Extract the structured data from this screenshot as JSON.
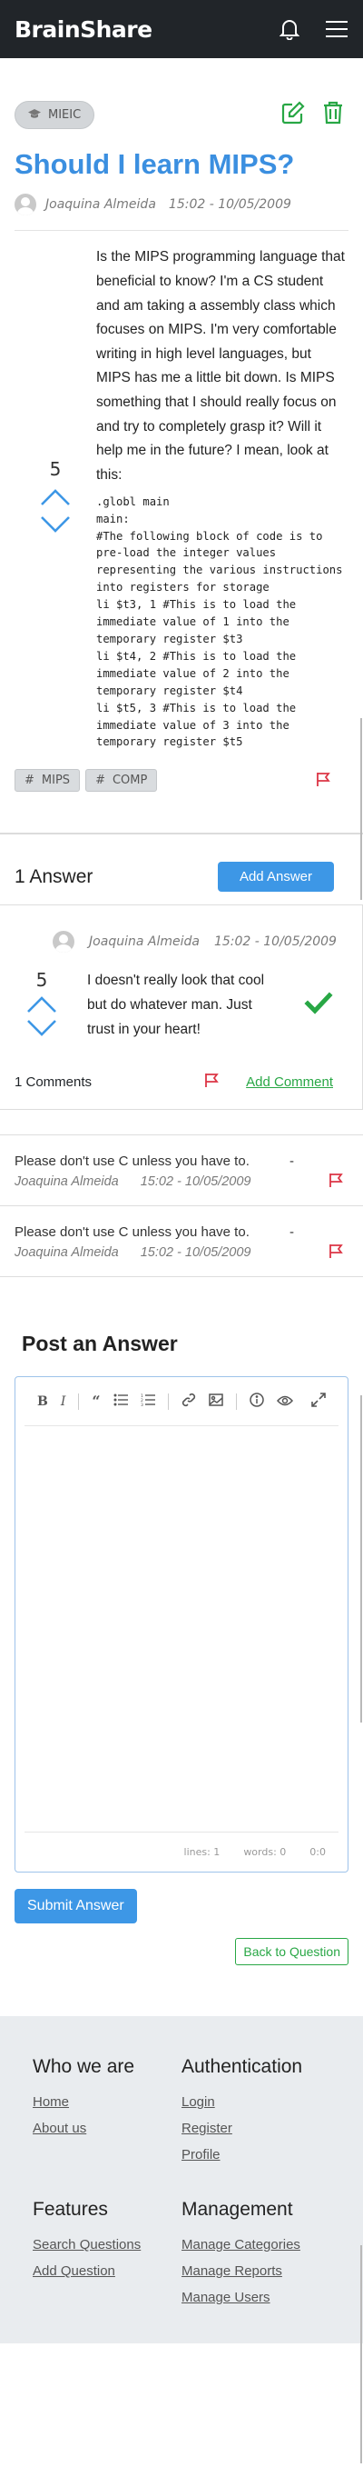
{
  "navbar": {
    "brand": "BrainShare",
    "icons": [
      "bell-icon",
      "menu-icon"
    ]
  },
  "question": {
    "category": "MIEIC",
    "title": "Should I learn MIPS?",
    "author": "Joaquina Almeida",
    "date": "15:02 - 10/05/2009",
    "votes": "5",
    "body": "Is the MIPS programming language that beneficial to know? I'm a CS student and am taking a assembly class which focuses on MIPS. I'm very comfortable writing in high level languages, but MIPS has me a little bit down. Is MIPS something that I should really focus on and try to completely grasp it? Will it help me in the future? I mean, look at this:",
    "code": ".globl main\nmain:\n#The following block of code is to pre-load the integer values representing the various instructions into registers for storage\nli $t3, 1 #This is to load the immediate value of 1 into the temporary register $t3\nli $t4, 2 #This is to load the immediate value of 2 into the temporary register $t4\nli $t5, 3 #This is to load the immediate value of 3 into the temporary register $t5",
    "tags": [
      "MIPS",
      "COMP"
    ]
  },
  "answers": {
    "count_label": "1 Answer",
    "add_label": "Add Answer",
    "items": [
      {
        "author": "Joaquina Almeida",
        "date": "15:02 - 10/05/2009",
        "votes": "5",
        "text": "I doesn't really look that cool but do whatever man. Just trust in your heart!",
        "comments_label": "1 Comments",
        "add_comment_label": "Add Comment"
      }
    ]
  },
  "comments": [
    {
      "text": "Please don't use C unless you have to.",
      "dash": "-",
      "author": "Joaquina Almeida",
      "date": "15:02 - 10/05/2009"
    },
    {
      "text": "Please don't use C unless you have to.",
      "dash": "-",
      "author": "Joaquina Almeida",
      "date": "15:02 - 10/05/2009"
    }
  ],
  "post_answer": {
    "title": "Post an Answer",
    "status_lines": "lines: 1",
    "status_words": "words: 0",
    "status_cursor": "0:0",
    "submit_label": "Submit Answer",
    "back_label": "Back to Question"
  },
  "footer": {
    "who": {
      "title": "Who we are",
      "links": [
        "Home",
        "About us"
      ]
    },
    "auth": {
      "title": "Authentication",
      "links": [
        "Login",
        "Register",
        "Profile"
      ]
    },
    "features": {
      "title": "Features",
      "links": [
        "Search Questions",
        "Add Question"
      ]
    },
    "management": {
      "title": "Management",
      "links": [
        "Manage Categories",
        "Manage Reports",
        "Manage Users"
      ]
    }
  },
  "colors": {
    "brand_blue": "#3b8fe0",
    "success": "#28a745",
    "danger": "#dc3545",
    "navbar": "#212529"
  }
}
